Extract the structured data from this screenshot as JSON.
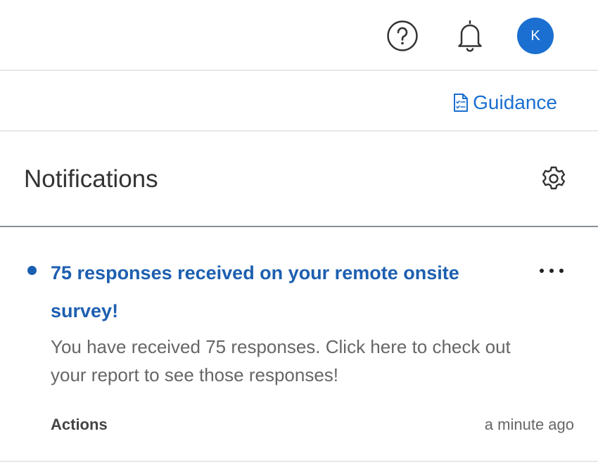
{
  "header": {
    "help_icon": "question-circle-icon",
    "bell_icon": "bell-icon",
    "avatar_initial": "K",
    "avatar_color": "#1a6fd1"
  },
  "guidance": {
    "icon": "document-checklist-icon",
    "label": "Guidance"
  },
  "notifications": {
    "title": "Notifications",
    "settings_icon": "gear-icon",
    "items": [
      {
        "unread": true,
        "title": "75 responses received on your remote onsite survey!",
        "body": "You have received 75 responses. Click here to check out your report to see those responses!",
        "actions_label": "Actions",
        "timestamp": "a minute ago",
        "menu_icon": "more-horizontal-icon"
      }
    ]
  },
  "colors": {
    "accent": "#1a6fd1",
    "title_link": "#1d5fb0",
    "text_primary": "#333333",
    "text_secondary": "#666666"
  }
}
